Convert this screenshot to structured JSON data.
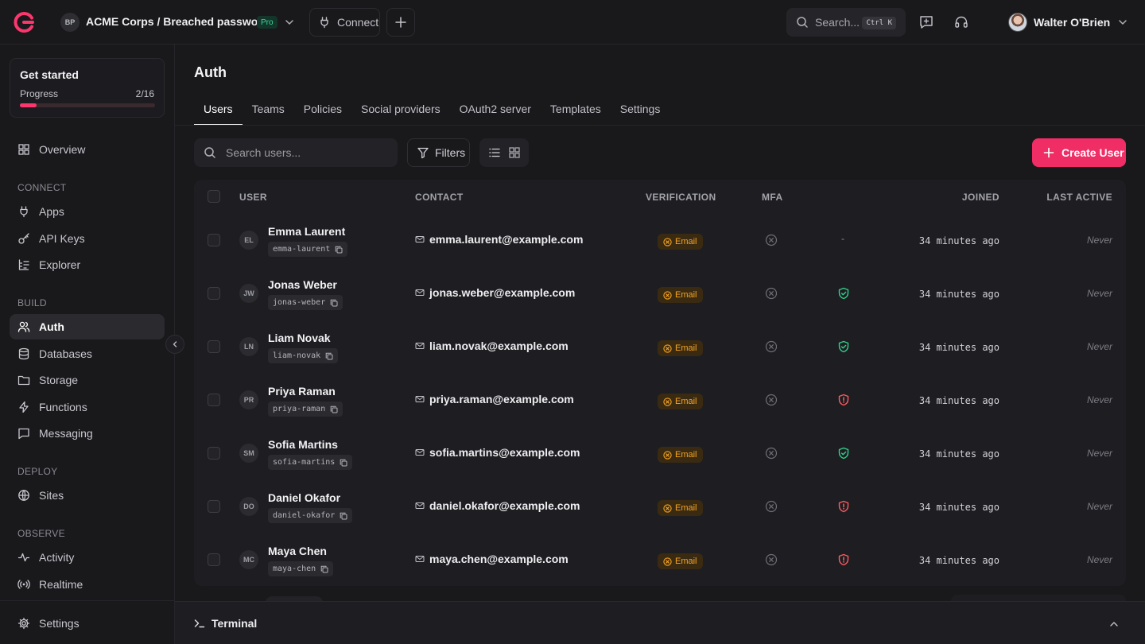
{
  "topbar": {
    "org_initials": "BP",
    "breadcrumb": "ACME Corps / Breached passwords",
    "plan_badge": "Pro",
    "connect_label": "Connect",
    "search_placeholder": "Search...",
    "search_shortcut": "Ctrl K",
    "user_name": "Walter O'Brien",
    "accent_color": "#fd366e"
  },
  "sidebar": {
    "get_started": {
      "title": "Get started",
      "progress_label": "Progress",
      "progress_text": "2/16",
      "progress_fraction": 0.125
    },
    "overview": "Overview",
    "sections": {
      "connect": "CONNECT",
      "build": "BUILD",
      "deploy": "DEPLOY",
      "observe": "OBSERVE"
    },
    "items": {
      "apps": "Apps",
      "api_keys": "API Keys",
      "explorer": "Explorer",
      "auth": "Auth",
      "databases": "Databases",
      "storage": "Storage",
      "functions": "Functions",
      "messaging": "Messaging",
      "sites": "Sites",
      "activity": "Activity",
      "realtime": "Realtime",
      "settings": "Settings"
    }
  },
  "main": {
    "title": "Auth",
    "tabs": [
      "Users",
      "Teams",
      "Policies",
      "Social providers",
      "OAuth2 server",
      "Templates",
      "Settings"
    ],
    "active_tab": "Users",
    "search_placeholder": "Search users...",
    "filters_label": "Filters",
    "create_label": "Create User"
  },
  "table": {
    "headers": {
      "user": "USER",
      "contact": "CONTACT",
      "verification": "VERIFICATION",
      "mfa": "MFA",
      "joined": "JOINED",
      "last_active": "LAST ACTIVE"
    },
    "rows": [
      {
        "initials": "EL",
        "name": "Emma Laurent",
        "id": "emma-laurent",
        "email": "emma.laurent@example.com",
        "verification": "Email",
        "mfa_icon": "x-circle-icon",
        "status": "-",
        "joined": "34 minutes ago",
        "last_active": "Never"
      },
      {
        "initials": "JW",
        "name": "Jonas Weber",
        "id": "jonas-weber",
        "email": "jonas.weber@example.com",
        "verification": "Email",
        "mfa_icon": "x-circle-icon",
        "status": "shield-check-icon",
        "joined": "34 minutes ago",
        "last_active": "Never"
      },
      {
        "initials": "LN",
        "name": "Liam Novak",
        "id": "liam-novak",
        "email": "liam.novak@example.com",
        "verification": "Email",
        "mfa_icon": "x-circle-icon",
        "status": "shield-check-icon",
        "joined": "34 minutes ago",
        "last_active": "Never"
      },
      {
        "initials": "PR",
        "name": "Priya Raman",
        "id": "priya-raman",
        "email": "priya.raman@example.com",
        "verification": "Email",
        "mfa_icon": "x-circle-icon",
        "status": "shield-alert-icon",
        "joined": "34 minutes ago",
        "last_active": "Never"
      },
      {
        "initials": "SM",
        "name": "Sofia Martins",
        "id": "sofia-martins",
        "email": "sofia.martins@example.com",
        "verification": "Email",
        "mfa_icon": "x-circle-icon",
        "status": "shield-check-icon",
        "joined": "34 minutes ago",
        "last_active": "Never"
      },
      {
        "initials": "DO",
        "name": "Daniel Okafor",
        "id": "daniel-okafor",
        "email": "daniel.okafor@example.com",
        "verification": "Email",
        "mfa_icon": "x-circle-icon",
        "status": "shield-alert-icon",
        "joined": "34 minutes ago",
        "last_active": "Never"
      },
      {
        "initials": "MC",
        "name": "Maya Chen",
        "id": "maya-chen",
        "email": "maya.chen@example.com",
        "verification": "Email",
        "mfa_icon": "x-circle-icon",
        "status": "shield-alert-icon",
        "joined": "34 minutes ago",
        "last_active": "Never"
      }
    ],
    "status_colors": {
      "ok": "#2fd28a",
      "alert": "#ff5a5f",
      "warning": "#f5a524"
    }
  },
  "terminal": {
    "label": "Terminal"
  }
}
